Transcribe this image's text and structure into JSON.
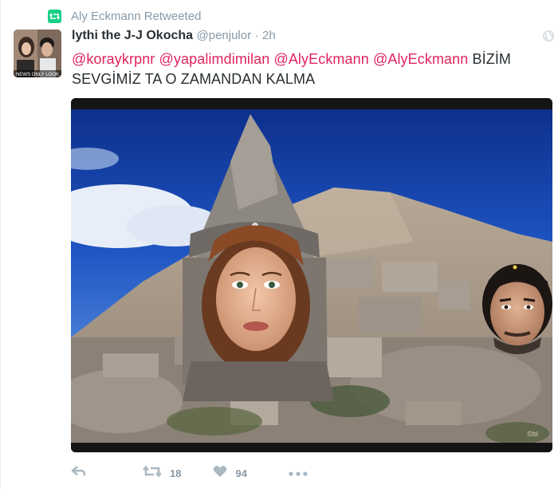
{
  "retweet_context": {
    "icon": "retweet-icon",
    "text": "Aly Eckmann Retweeted",
    "accent": "#19cf86"
  },
  "tweet": {
    "display_name": "lythi the J-J Okocha",
    "handle": "@penjulor",
    "separator": "·",
    "time": "2h",
    "mentions": [
      "@koraykrpnr",
      "@yapalimdimilan",
      "@AlyEckmann",
      "@AlyEckmann"
    ],
    "body_rest_line1": "BİZİM",
    "body_line2": "SEVGİMİZ TA O ZAMANDAN KALMA",
    "mention_color": "#e0245e",
    "avatar_caption": "NEWS ONLY LOOK"
  },
  "media": {
    "watermark": "©bl"
  },
  "actions": {
    "reply_icon": "reply-icon",
    "retweet_icon": "retweet-icon",
    "retweet_count": "18",
    "like_icon": "heart-icon",
    "like_count": "94",
    "more_icon": "more-icon"
  }
}
